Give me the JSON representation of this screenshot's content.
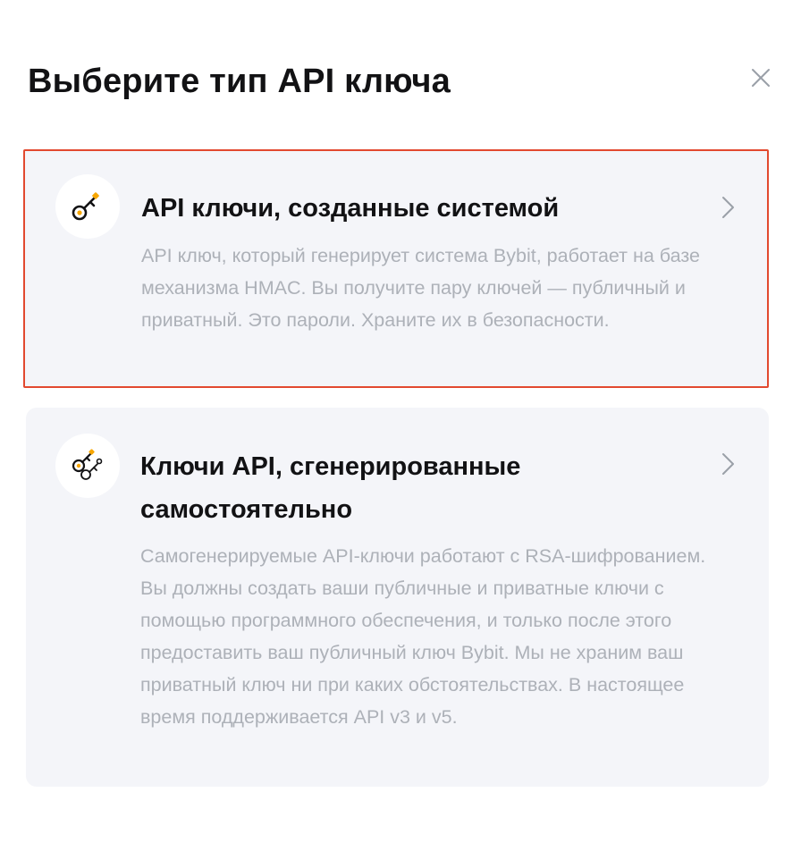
{
  "dialog": {
    "title": "Выберите тип API ключа",
    "close_icon": "close-icon"
  },
  "options": [
    {
      "title": "API ключи, созданные системой",
      "description": "API ключ, который генерирует система Bybit, работает на базе механизма HMAC. Вы получите пару ключей — публичный и приватный. Это пароли. Храните их в безопасности.",
      "icon": "key-icon",
      "selected": true
    },
    {
      "title": "Ключи API, сгенерированные самостоятельно",
      "description": "Самогенерируемые API-ключи работают с RSA-шифрованием. Вы должны создать ваши публичные и приватные ключи с помощью программного обеспечения, и только после этого предоставить ваш публичный ключ Bybit. Мы не храним ваш приватный ключ ни при каких обстоятельствах. В настоящее время поддерживается API v3 и v5.",
      "icon": "self-generated-key-icon",
      "selected": false
    }
  ],
  "colors": {
    "accent": "#f7a600",
    "selected_border": "#e2492f",
    "card_background": "#f4f5f9",
    "description_text": "#adb1b8",
    "title_text": "#121214"
  }
}
